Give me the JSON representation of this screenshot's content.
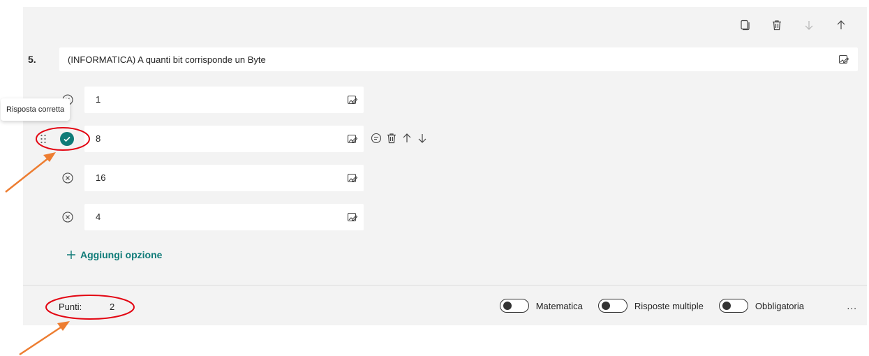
{
  "question": {
    "number": "5.",
    "text": "(INFORMATICA) A quanti bit corrisponde un Byte"
  },
  "options": [
    {
      "text": "1",
      "correct": false
    },
    {
      "text": "8",
      "correct": true
    },
    {
      "text": "16",
      "correct": false
    },
    {
      "text": "4",
      "correct": false
    }
  ],
  "tooltip": "Risposta corretta",
  "add_option_label": "Aggiungi opzione",
  "footer": {
    "points_label": "Punti:",
    "points_value": "2",
    "toggles": [
      {
        "label": "Matematica",
        "on": false
      },
      {
        "label": "Risposte multiple",
        "on": false
      },
      {
        "label": "Obbligatoria",
        "on": false
      }
    ],
    "more": "..."
  },
  "colors": {
    "accent": "#0f7b78",
    "annotation_red": "#e30613",
    "annotation_arrow": "#ed7d31"
  },
  "icons": {
    "toolbar": [
      "copy-icon",
      "trash-icon",
      "arrow-down-icon",
      "arrow-up-icon"
    ],
    "option_actions": [
      "comment-icon",
      "trash-icon",
      "arrow-up-icon",
      "arrow-down-icon"
    ]
  }
}
